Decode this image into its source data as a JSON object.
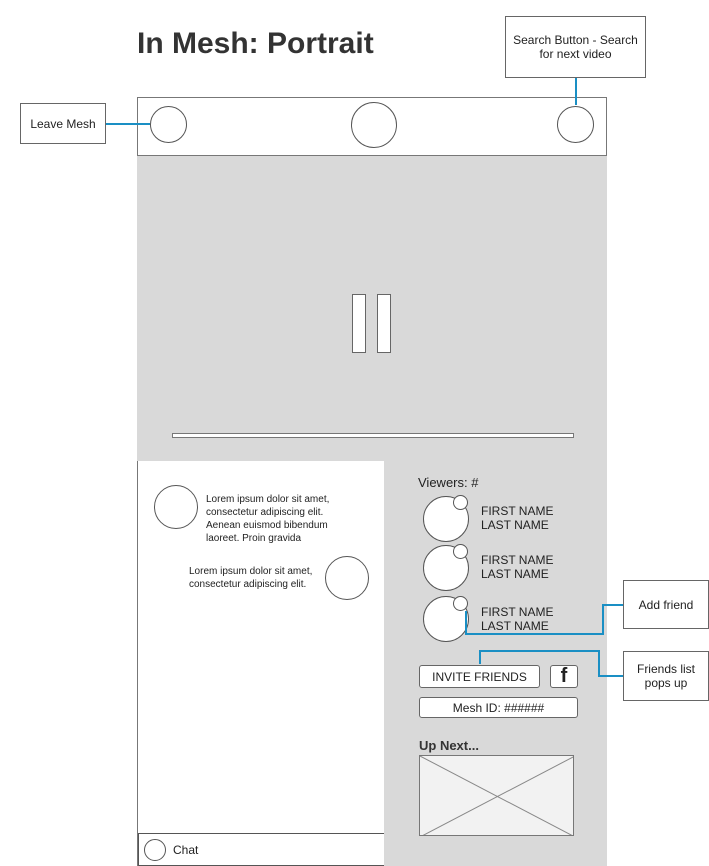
{
  "title": "In Mesh: Portrait",
  "callouts": {
    "search": "Search Button - Search for next video",
    "leave": "Leave Mesh",
    "add_friend": "Add friend",
    "friends_list": "Friends list pops up"
  },
  "chat": {
    "messages": [
      {
        "text": "Lorem ipsum dolor sit amet, consectetur adipiscing elit. Aenean euismod bibendum laoreet. Proin gravida",
        "side": "left"
      },
      {
        "text": "Lorem ipsum dolor sit amet, consectetur adipiscing elit.",
        "side": "right"
      }
    ],
    "input_label": "Chat"
  },
  "viewers": {
    "label": "Viewers: #",
    "list": [
      {
        "first": "FIRST NAME",
        "last": "LAST NAME"
      },
      {
        "first": "FIRST NAME",
        "last": "LAST NAME"
      },
      {
        "first": "FIRST NAME",
        "last": "LAST NAME"
      }
    ]
  },
  "invite_label": "INVITE FRIENDS",
  "facebook_glyph": "f",
  "mesh_id": "Mesh ID: ######",
  "up_next_label": "Up Next...",
  "colors": {
    "accent": "#1a8fc4",
    "panel": "#d9d9d9"
  }
}
